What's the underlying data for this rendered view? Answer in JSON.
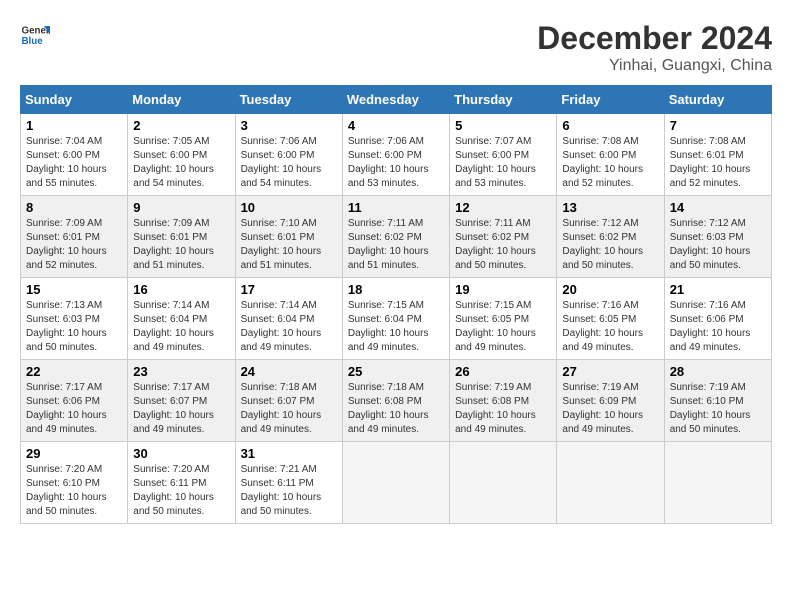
{
  "logo": {
    "general": "General",
    "blue": "Blue"
  },
  "header": {
    "month": "December 2024",
    "location": "Yinhai, Guangxi, China"
  },
  "weekdays": [
    "Sunday",
    "Monday",
    "Tuesday",
    "Wednesday",
    "Thursday",
    "Friday",
    "Saturday"
  ],
  "weeks": [
    [
      {
        "day": "1",
        "info": "Sunrise: 7:04 AM\nSunset: 6:00 PM\nDaylight: 10 hours\nand 55 minutes."
      },
      {
        "day": "2",
        "info": "Sunrise: 7:05 AM\nSunset: 6:00 PM\nDaylight: 10 hours\nand 54 minutes."
      },
      {
        "day": "3",
        "info": "Sunrise: 7:06 AM\nSunset: 6:00 PM\nDaylight: 10 hours\nand 54 minutes."
      },
      {
        "day": "4",
        "info": "Sunrise: 7:06 AM\nSunset: 6:00 PM\nDaylight: 10 hours\nand 53 minutes."
      },
      {
        "day": "5",
        "info": "Sunrise: 7:07 AM\nSunset: 6:00 PM\nDaylight: 10 hours\nand 53 minutes."
      },
      {
        "day": "6",
        "info": "Sunrise: 7:08 AM\nSunset: 6:00 PM\nDaylight: 10 hours\nand 52 minutes."
      },
      {
        "day": "7",
        "info": "Sunrise: 7:08 AM\nSunset: 6:01 PM\nDaylight: 10 hours\nand 52 minutes."
      }
    ],
    [
      {
        "day": "8",
        "info": "Sunrise: 7:09 AM\nSunset: 6:01 PM\nDaylight: 10 hours\nand 52 minutes."
      },
      {
        "day": "9",
        "info": "Sunrise: 7:09 AM\nSunset: 6:01 PM\nDaylight: 10 hours\nand 51 minutes."
      },
      {
        "day": "10",
        "info": "Sunrise: 7:10 AM\nSunset: 6:01 PM\nDaylight: 10 hours\nand 51 minutes."
      },
      {
        "day": "11",
        "info": "Sunrise: 7:11 AM\nSunset: 6:02 PM\nDaylight: 10 hours\nand 51 minutes."
      },
      {
        "day": "12",
        "info": "Sunrise: 7:11 AM\nSunset: 6:02 PM\nDaylight: 10 hours\nand 50 minutes."
      },
      {
        "day": "13",
        "info": "Sunrise: 7:12 AM\nSunset: 6:02 PM\nDaylight: 10 hours\nand 50 minutes."
      },
      {
        "day": "14",
        "info": "Sunrise: 7:12 AM\nSunset: 6:03 PM\nDaylight: 10 hours\nand 50 minutes."
      }
    ],
    [
      {
        "day": "15",
        "info": "Sunrise: 7:13 AM\nSunset: 6:03 PM\nDaylight: 10 hours\nand 50 minutes."
      },
      {
        "day": "16",
        "info": "Sunrise: 7:14 AM\nSunset: 6:04 PM\nDaylight: 10 hours\nand 49 minutes."
      },
      {
        "day": "17",
        "info": "Sunrise: 7:14 AM\nSunset: 6:04 PM\nDaylight: 10 hours\nand 49 minutes."
      },
      {
        "day": "18",
        "info": "Sunrise: 7:15 AM\nSunset: 6:04 PM\nDaylight: 10 hours\nand 49 minutes."
      },
      {
        "day": "19",
        "info": "Sunrise: 7:15 AM\nSunset: 6:05 PM\nDaylight: 10 hours\nand 49 minutes."
      },
      {
        "day": "20",
        "info": "Sunrise: 7:16 AM\nSunset: 6:05 PM\nDaylight: 10 hours\nand 49 minutes."
      },
      {
        "day": "21",
        "info": "Sunrise: 7:16 AM\nSunset: 6:06 PM\nDaylight: 10 hours\nand 49 minutes."
      }
    ],
    [
      {
        "day": "22",
        "info": "Sunrise: 7:17 AM\nSunset: 6:06 PM\nDaylight: 10 hours\nand 49 minutes."
      },
      {
        "day": "23",
        "info": "Sunrise: 7:17 AM\nSunset: 6:07 PM\nDaylight: 10 hours\nand 49 minutes."
      },
      {
        "day": "24",
        "info": "Sunrise: 7:18 AM\nSunset: 6:07 PM\nDaylight: 10 hours\nand 49 minutes."
      },
      {
        "day": "25",
        "info": "Sunrise: 7:18 AM\nSunset: 6:08 PM\nDaylight: 10 hours\nand 49 minutes."
      },
      {
        "day": "26",
        "info": "Sunrise: 7:19 AM\nSunset: 6:08 PM\nDaylight: 10 hours\nand 49 minutes."
      },
      {
        "day": "27",
        "info": "Sunrise: 7:19 AM\nSunset: 6:09 PM\nDaylight: 10 hours\nand 49 minutes."
      },
      {
        "day": "28",
        "info": "Sunrise: 7:19 AM\nSunset: 6:10 PM\nDaylight: 10 hours\nand 50 minutes."
      }
    ],
    [
      {
        "day": "29",
        "info": "Sunrise: 7:20 AM\nSunset: 6:10 PM\nDaylight: 10 hours\nand 50 minutes."
      },
      {
        "day": "30",
        "info": "Sunrise: 7:20 AM\nSunset: 6:11 PM\nDaylight: 10 hours\nand 50 minutes."
      },
      {
        "day": "31",
        "info": "Sunrise: 7:21 AM\nSunset: 6:11 PM\nDaylight: 10 hours\nand 50 minutes."
      },
      {
        "day": "",
        "info": ""
      },
      {
        "day": "",
        "info": ""
      },
      {
        "day": "",
        "info": ""
      },
      {
        "day": "",
        "info": ""
      }
    ]
  ]
}
